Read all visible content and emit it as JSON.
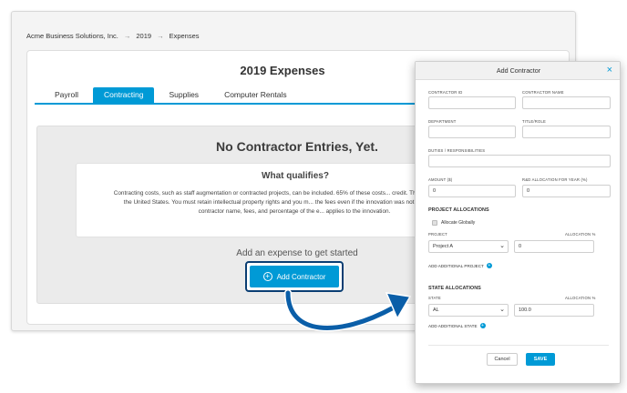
{
  "breadcrumb": {
    "company": "Acme Business Solutions, Inc.",
    "year": "2019",
    "page": "Expenses",
    "separator": "→"
  },
  "page": {
    "title": "2019 Expenses"
  },
  "tabs": [
    {
      "label": "Payroll",
      "active": false
    },
    {
      "label": "Contracting",
      "active": true
    },
    {
      "label": "Supplies",
      "active": false
    },
    {
      "label": "Computer Rentals",
      "active": false
    }
  ],
  "empty_state": {
    "title": "No Contractor Entries, Yet.",
    "qualifies_title": "What qualifies?",
    "qualifies_text": "Contracting costs, such as staff augmentation or contracted projects, can be included. 65% of these costs... credit. The activity must occur in the United States. You must retain intellectual property rights and you m... the fees even if the innovation was not successful. List the contractor name, fees, and percentage of the e... applies to the innovation.",
    "cta_text": "Add an expense to get started",
    "add_button_label": "Add Contractor"
  },
  "modal": {
    "title": "Add Contractor",
    "close_icon": "×",
    "fields": {
      "contractor_id_label": "Contractor ID",
      "contractor_name_label": "Contractor Name",
      "department_label": "Department",
      "title_role_label": "Title/Role",
      "duties_label": "Duties / Responsibilities",
      "amount_label": "Amount ($)",
      "amount_value": "0",
      "rnd_allocation_label": "R&D Allocation for Year (%)",
      "rnd_allocation_value": "0"
    },
    "project_allocations": {
      "title": "PROJECT ALLOCATIONS",
      "allocate_globally_label": "Allocate Globally",
      "allocate_globally_checked": false,
      "project_label": "PROJECT",
      "allocation_label": "ALLOCATION %",
      "project_value": "Project A",
      "allocation_value": "0",
      "add_link": "ADD ADDITIONAL PROJECT"
    },
    "state_allocations": {
      "title": "STATE ALLOCATIONS",
      "state_label": "STATE",
      "allocation_label": "ALLOCATION %",
      "state_value": "AL",
      "allocation_value": "100.0",
      "add_link": "ADD ADDITIONAL STATE"
    },
    "cancel_label": "Cancel",
    "save_label": "SAVE"
  },
  "colors": {
    "accent": "#009ad6",
    "highlight_border": "#0a3e73",
    "arrow": "#0a5ea8"
  }
}
